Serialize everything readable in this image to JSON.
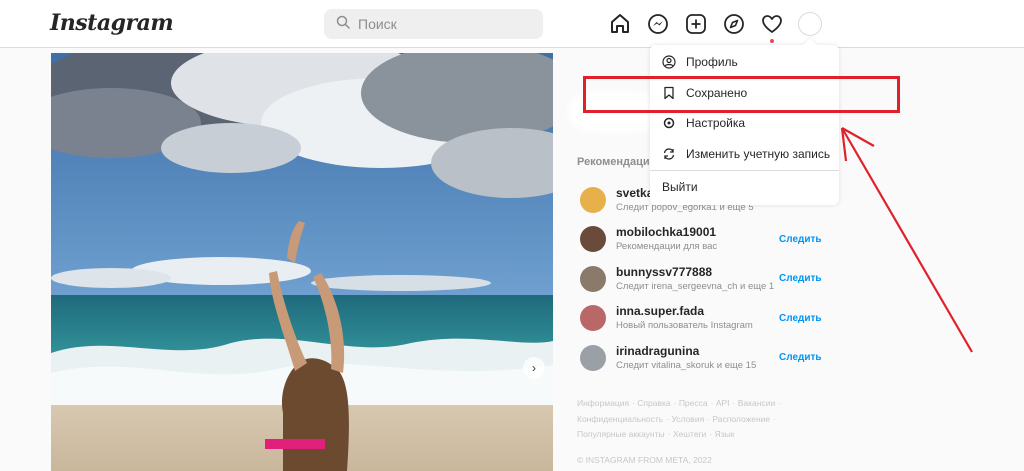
{
  "header": {
    "logo": "Instagram",
    "search_placeholder": "Поиск",
    "icons": [
      "home-icon",
      "messenger-icon",
      "new-post-icon",
      "explore-icon",
      "heart-icon"
    ]
  },
  "post": {
    "description": "",
    "carousel_next": "›"
  },
  "dropdown": {
    "items": [
      {
        "label": "Профиль",
        "icon": "profile-icon"
      },
      {
        "label": "Сохранено",
        "icon": "bookmark-icon"
      },
      {
        "label": "Настройка",
        "icon": "settings-icon"
      },
      {
        "label": "Изменить учетную запись",
        "icon": "switch-account-icon"
      }
    ],
    "logout": "Выйти"
  },
  "sidebar": {
    "recommendations_title": "Рекомендации",
    "follow_label": "Следить",
    "suggestions": [
      {
        "username": "svetka",
        "subtitle": "Следит popov_egorka1 и еще 5",
        "avatar_color": "#e8b04a",
        "show_follow": false
      },
      {
        "username": "mobilochka19001",
        "subtitle": "Рекомендации для вас",
        "avatar_color": "#6a4a3a",
        "show_follow": true
      },
      {
        "username": "bunnyssv777888",
        "subtitle": "Следит irena_sergeevna_ch и еще 1",
        "avatar_color": "#8a7a6a",
        "show_follow": true
      },
      {
        "username": "inna.super.fada",
        "subtitle": "Новый пользователь Instagram",
        "avatar_color": "#b9686a",
        "show_follow": true
      },
      {
        "username": "irinadragunina",
        "subtitle": "Следит vitalina_skoruk и еще 15",
        "avatar_color": "#9aa0a6",
        "show_follow": true
      }
    ],
    "footer_links": [
      "Информация",
      "Справка",
      "Пресса",
      "API",
      "Вакансии",
      "Конфиденциальность",
      "Условия",
      "Расположение",
      "Популярные аккаунты",
      "Хештеги",
      "Язык"
    ],
    "copyright": "© INSTAGRAM FROM META, 2022"
  },
  "colors": {
    "accent_blue": "#0095f6",
    "annotation_red": "#e0202a",
    "notification_red": "#ed4956"
  }
}
